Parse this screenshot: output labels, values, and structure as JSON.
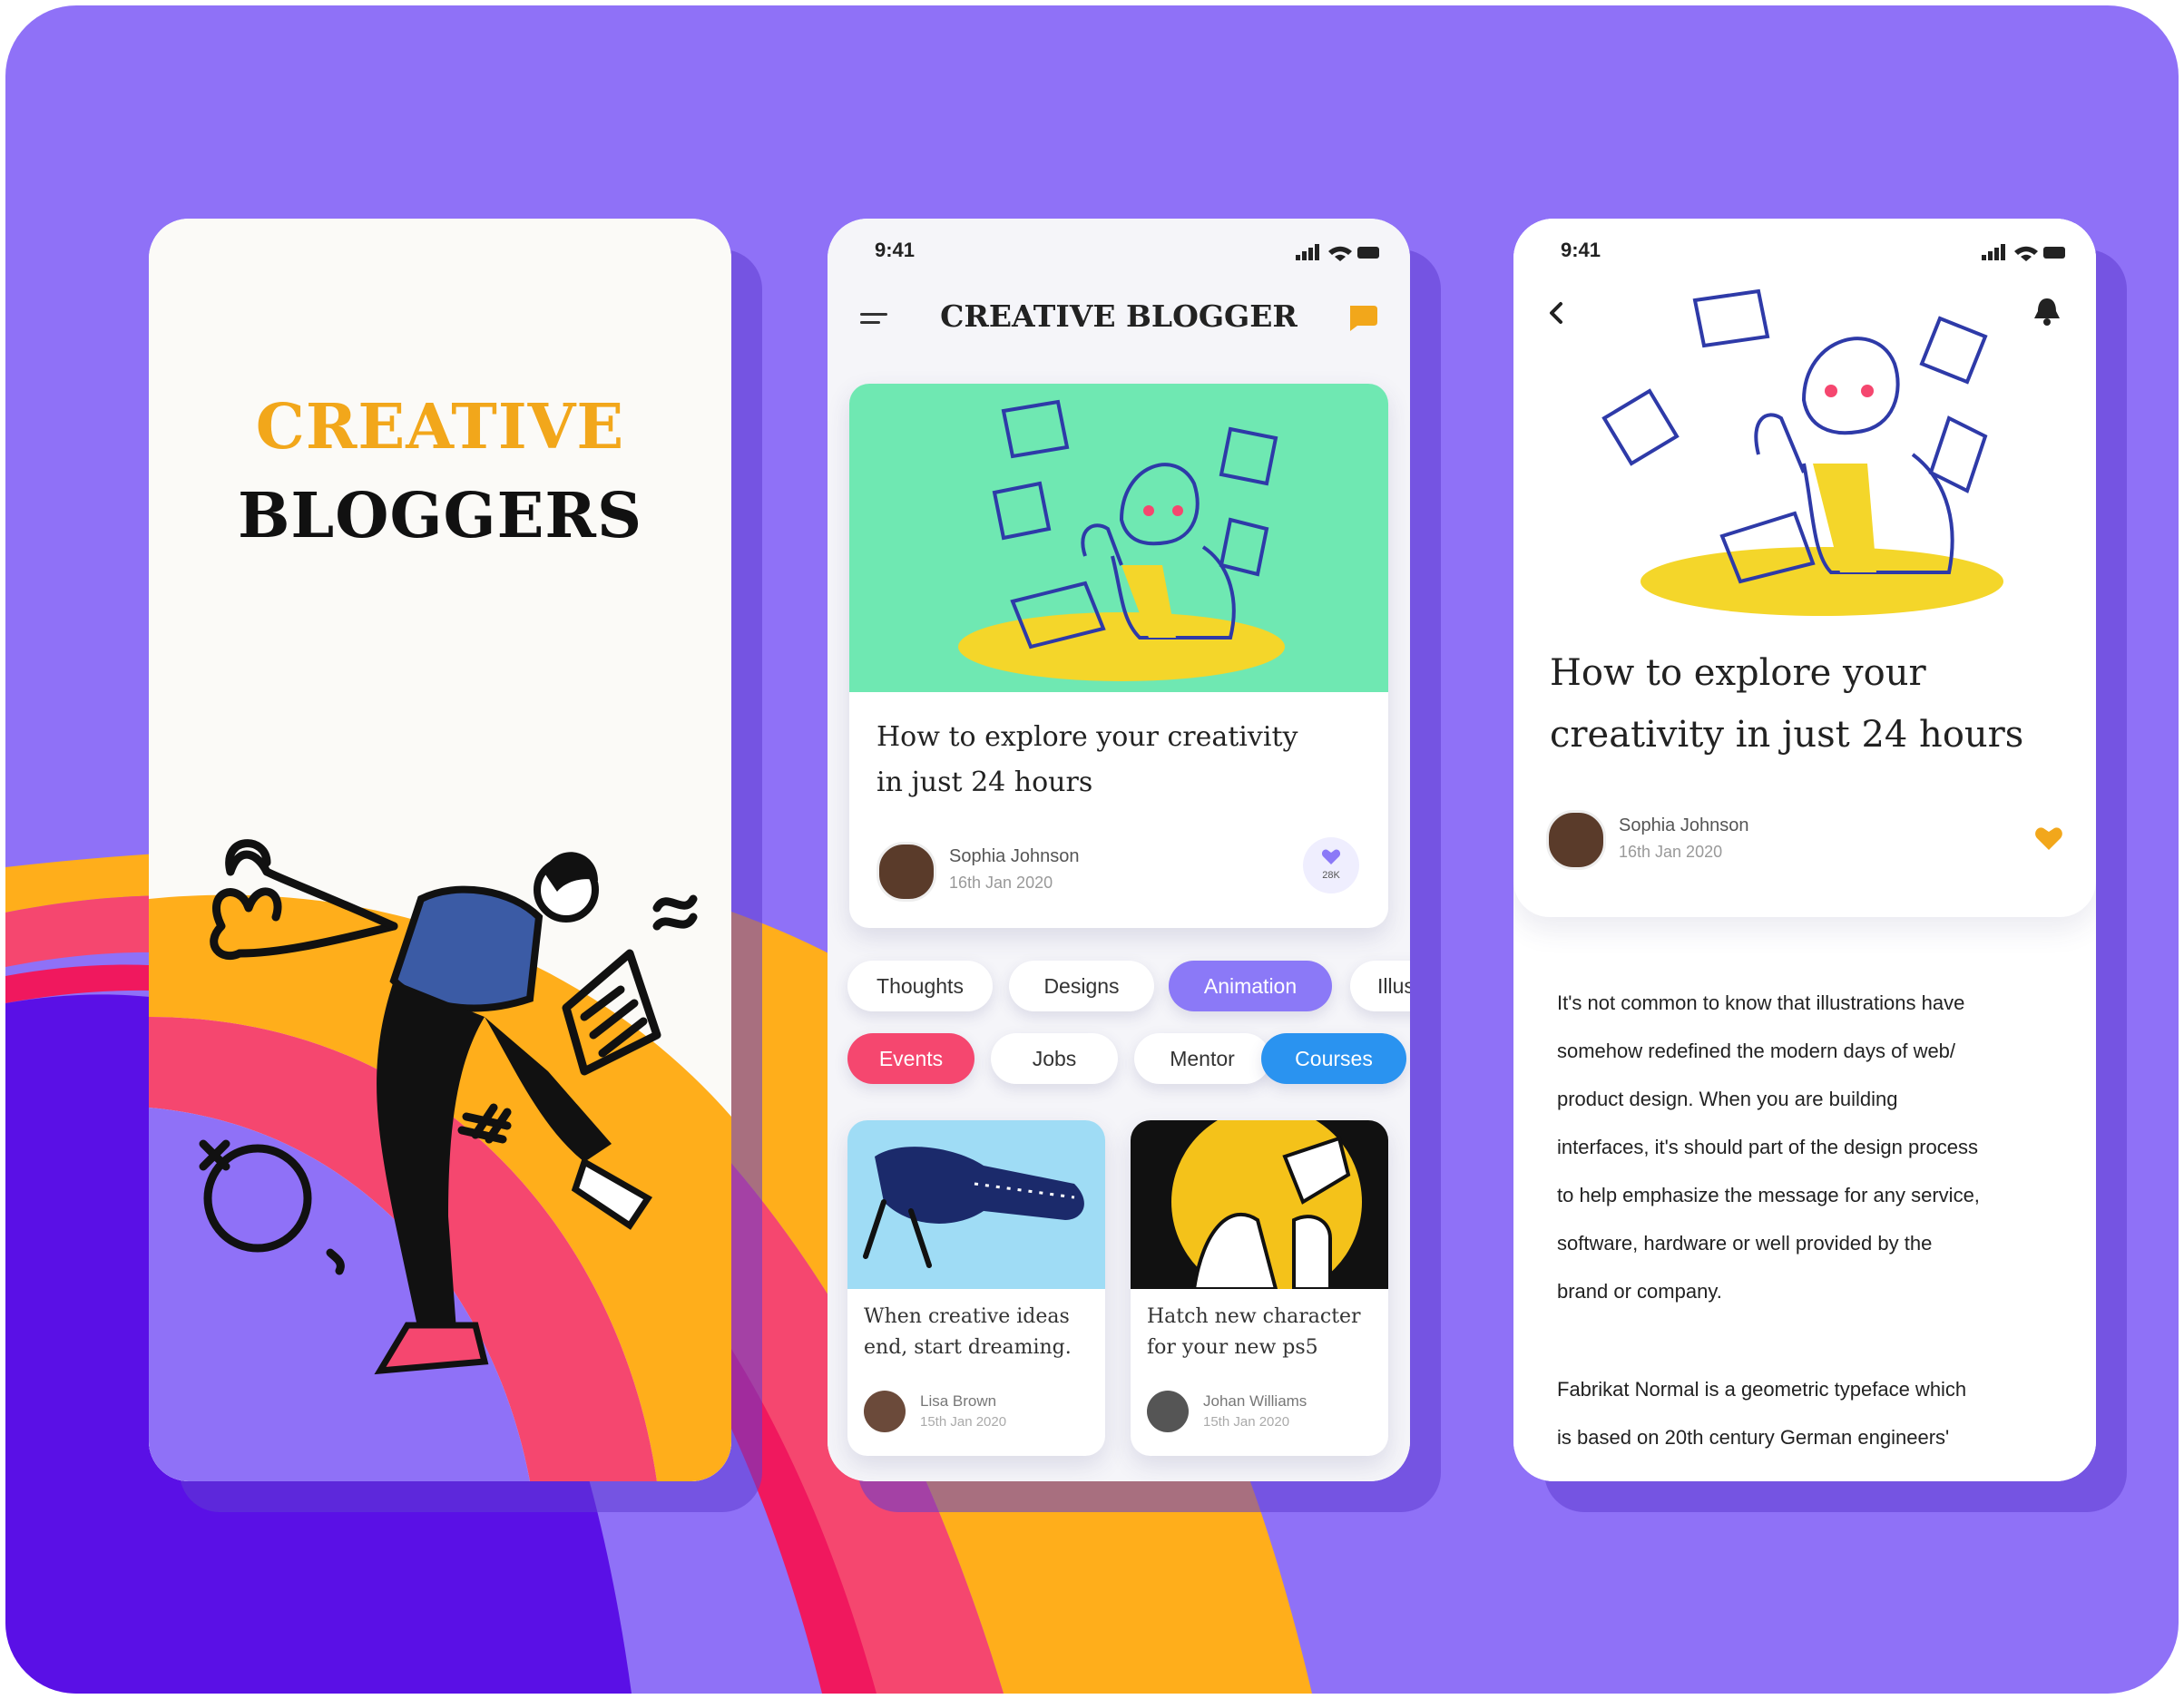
{
  "colors": {
    "background": "#8f71f7",
    "brand_yellow": "#f2a71b",
    "accent_purple": "#8b79f7",
    "pink": "#f5476f",
    "blue": "#2a93f0",
    "hero_green": "#6fe8b2",
    "illustration_yellow": "#f4d62a"
  },
  "splash": {
    "title_line1": "CREATIVE",
    "title_line2": "BLOGGERS"
  },
  "home": {
    "status_time": "9:41",
    "menu_icon": "hamburger-icon",
    "app_title": "CREATIVE BLOGGER",
    "chat_icon": "chat-bubble-icon",
    "featured": {
      "title_line1": "How to explore your creativity",
      "title_line2": "in just 24 hours",
      "author": "Sophia Johnson",
      "date": "16th Jan 2020",
      "likes": "28K"
    },
    "categories_row1": [
      {
        "label": "Thoughts",
        "state": "default"
      },
      {
        "label": "Designs",
        "state": "default"
      },
      {
        "label": "Animation",
        "state": "selected-purple"
      },
      {
        "label": "Illus",
        "state": "default"
      }
    ],
    "categories_row2": [
      {
        "label": "Events",
        "state": "selected-pink"
      },
      {
        "label": "Jobs",
        "state": "default"
      },
      {
        "label": "Mentor",
        "state": "default"
      },
      {
        "label": "Courses",
        "state": "selected-blue"
      }
    ],
    "posts": [
      {
        "title_line1": "When creative ideas",
        "title_line2": "end, start dreaming.",
        "author": "Lisa Brown",
        "date": "15th Jan 2020"
      },
      {
        "title_line1": "Hatch new character",
        "title_line2": "for your new ps5",
        "author": "Johan Williams",
        "date": "15th Jan 2020"
      }
    ]
  },
  "article": {
    "status_time": "9:41",
    "back_icon": "back-chevron-icon",
    "bell_icon": "bell-icon",
    "title_line1": "How to explore your",
    "title_line2": "creativity in just 24 hours",
    "author": "Sophia Johnson",
    "date": "16th Jan 2020",
    "heart_icon": "heart-icon",
    "body_lines": [
      "It's not common to know that illustrations have",
      "somehow redefined the modern days of web/",
      "product design. When you are building",
      "interfaces, it's should part of the design process",
      "to help emphasize the message for any service,",
      "software, hardware or well provided by the",
      "brand or company."
    ],
    "body2_lines": [
      "Fabrikat Normal is a geometric typeface which",
      "is based on 20th century German engineers'"
    ]
  }
}
